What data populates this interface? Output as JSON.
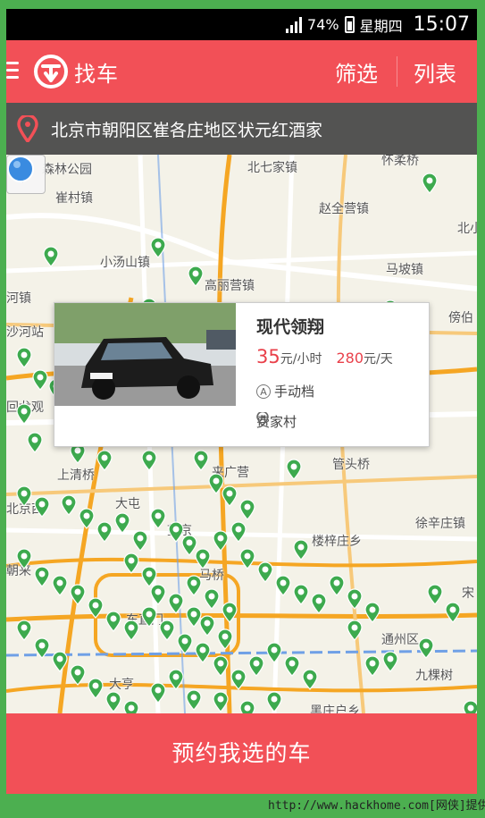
{
  "status_bar": {
    "battery": "74%",
    "day": "星期四",
    "time": "15:07"
  },
  "app_bar": {
    "title": "找车",
    "filter_label": "筛选",
    "list_label": "列表"
  },
  "address": {
    "text": "北京市朝阳区崔各庄地区状元红酒家"
  },
  "map": {
    "places": [
      "来广营",
      "崔村镇",
      "赵全营镇",
      "北小",
      "小汤山镇",
      "马坡镇",
      "高丽营镇",
      "河镇",
      "傍伯",
      "沙河站",
      "回龙观",
      "管头桥",
      "上清桥",
      "北京西",
      "大屯",
      "望京",
      "楼梓庄乡",
      "徐辛庄镇",
      "马桥",
      "东直门",
      "九棵树",
      "通州区",
      "黑庄户乡",
      "朝来",
      "宋",
      "大亨",
      "森林公园",
      "怀柔桥",
      "北七家镇"
    ]
  },
  "popup": {
    "car_name": "现代领翔",
    "hourly_price": "35",
    "hourly_unit": "元/小时",
    "daily_price": "280",
    "daily_unit": "元/天",
    "gear_badge": "A",
    "transmission": "手动档",
    "location": "费家村"
  },
  "book_button": {
    "label": "预约我选的车"
  },
  "watermark": {
    "text": "http://www.hackhome.com[网侠]提供"
  },
  "colors": {
    "brand_red": "#f25057",
    "marker_green": "#3daa4e",
    "route_orange": "#f5a623",
    "price_red": "#e9404a"
  }
}
